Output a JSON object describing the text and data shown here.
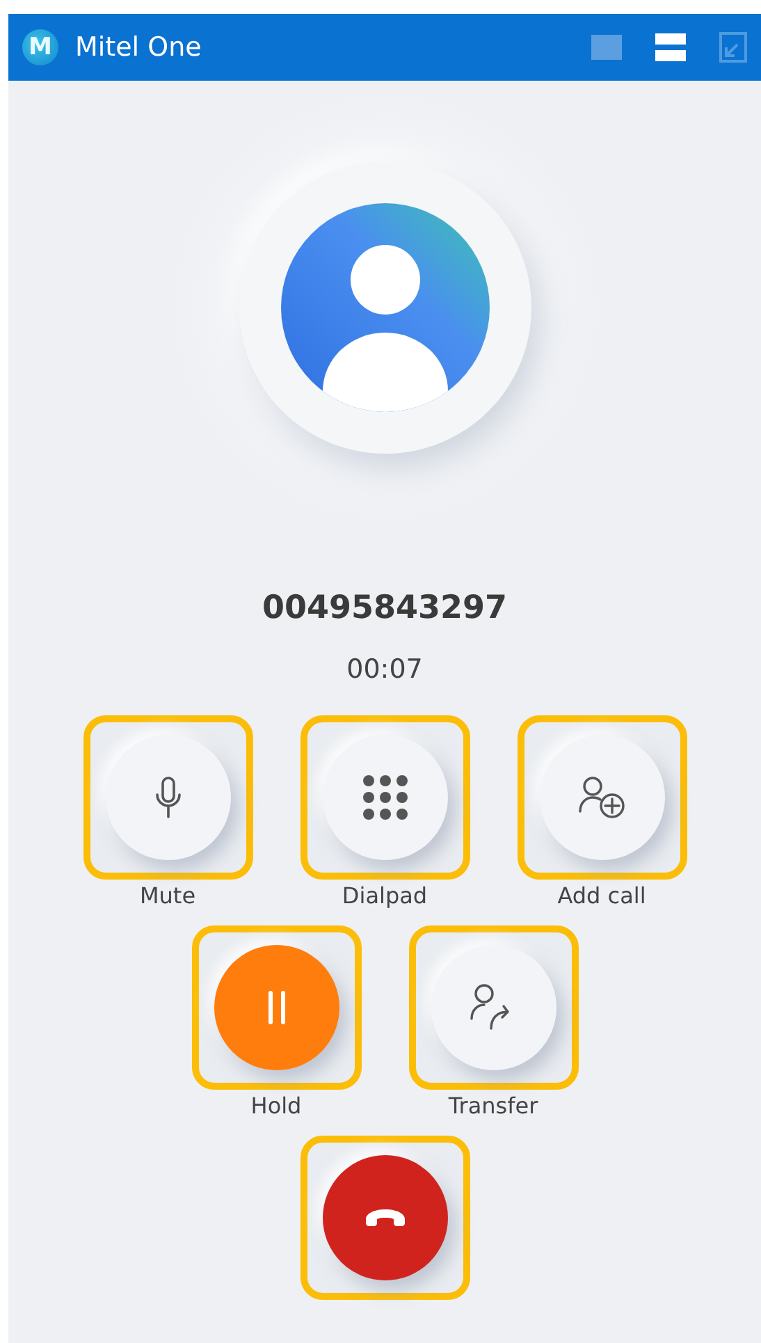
{
  "window": {
    "title": "Mitel One",
    "logo": "M"
  },
  "call": {
    "number": "00495843297",
    "duration": "00:07"
  },
  "controls": [
    [
      {
        "kind": "mute",
        "label": "Mute",
        "highlighted": true
      },
      {
        "kind": "dialpad",
        "label": "Dialpad",
        "highlighted": true
      },
      {
        "kind": "add-call",
        "label": "Add call",
        "highlighted": true
      }
    ],
    [
      {
        "kind": "hold",
        "label": "Hold",
        "highlighted": true
      },
      {
        "kind": "transfer",
        "label": "Transfer",
        "highlighted": true
      }
    ],
    [
      {
        "kind": "hangup",
        "highlighted": true
      }
    ]
  ]
}
